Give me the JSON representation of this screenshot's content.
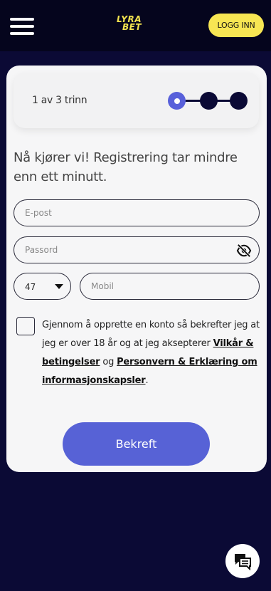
{
  "header": {
    "logo_line1": "LYRA",
    "logo_line2": "BET",
    "login_label": "LOGG INN"
  },
  "steps": {
    "label": "1 av 3 trinn",
    "current": 1,
    "total": 3
  },
  "form": {
    "headline": "Nå kjører vi! Registrering tar mindre enn ett minutt.",
    "email_placeholder": "E-post",
    "password_placeholder": "Passord",
    "country_code": "47",
    "mobile_placeholder": "Mobil",
    "terms_prefix": "Gjennom å opprette en konto så bekrefter jeg at jeg er over 18 år og at jeg aksepterer ",
    "terms_link": "Vilkår & betingelser",
    "terms_middle": " og ",
    "privacy_link": "Personvern & Erklæring om informasjonskapsler",
    "terms_suffix": ".",
    "confirm_label": "Bekreft"
  },
  "colors": {
    "background": "#0b0a35",
    "topbar": "#05051d",
    "accent": "#5762d6",
    "login_yellow": "#f7e653"
  },
  "icons": {
    "menu": "hamburger-menu-icon",
    "eye": "eye-off-icon",
    "caret": "caret-down-icon",
    "chat": "chat-bubbles-icon"
  }
}
